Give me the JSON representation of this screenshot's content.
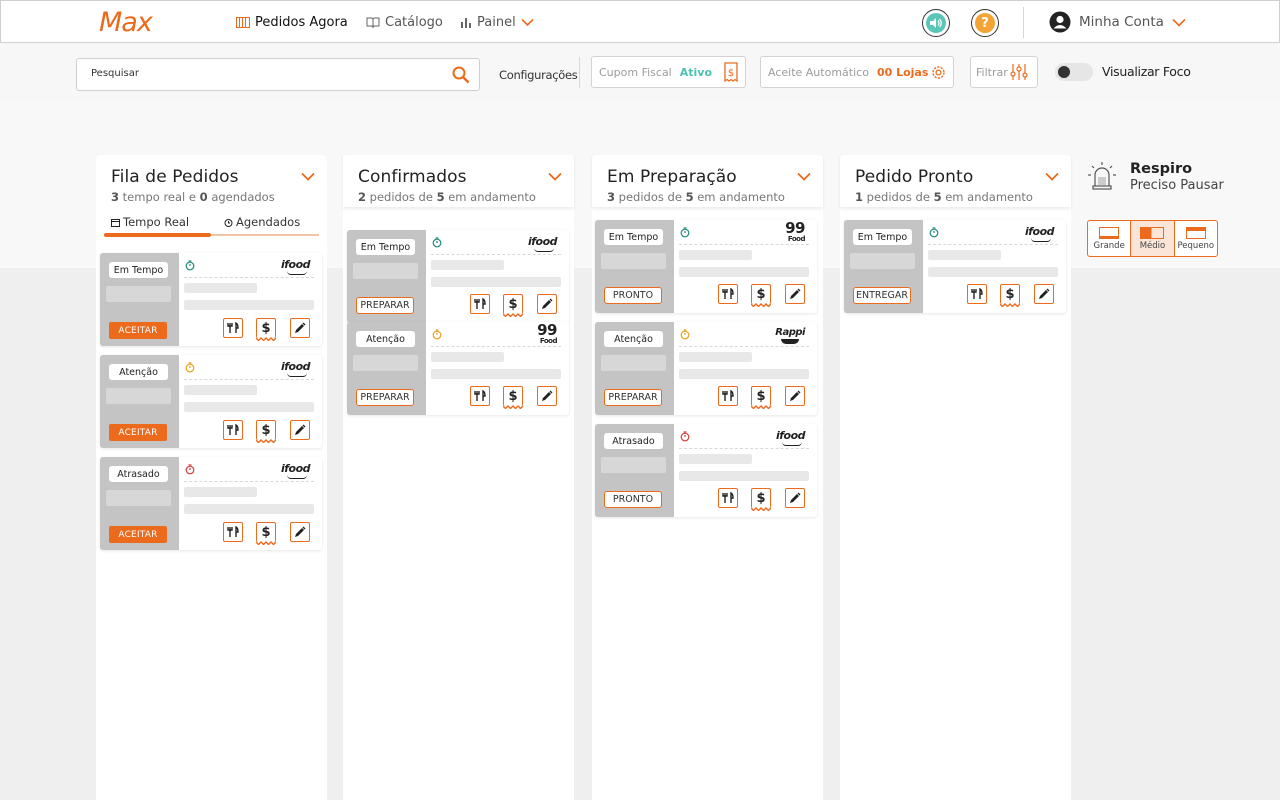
{
  "brand": {
    "logo": "Max",
    "accent": "#ec6a1c"
  },
  "nav": {
    "pedidos": "Pedidos Agora",
    "catalogo": "Catálogo",
    "painel": "Painel",
    "account": "Minha Conta"
  },
  "toolbar": {
    "search_placeholder": "Pesquisar",
    "config": "Configurações",
    "cupom_label": "Cupom Fiscal",
    "cupom_status": "Ativo",
    "aceite_label": "Aceite Automático",
    "aceite_value": "00 Lojas",
    "filtrar": "Filtrar",
    "foco": "Visualizar Foco"
  },
  "columns": [
    {
      "title": "Fila de Pedidos",
      "sub": {
        "n1": "3",
        "t1": "tempo real e",
        "n2": "0",
        "t2": "agendados"
      },
      "tabs": [
        "Tempo Real",
        "Agendados"
      ],
      "cards": [
        {
          "status": "Em Tempo",
          "action": "ACEITAR",
          "platform": "ifood",
          "clock_color": "#1f8a7a"
        },
        {
          "status": "Atenção",
          "action": "ACEITAR",
          "platform": "ifood",
          "clock_color": "#e6a11c"
        },
        {
          "status": "Atrasado",
          "action": "ACEITAR",
          "platform": "ifood",
          "clock_color": "#d93a3a"
        }
      ]
    },
    {
      "title": "Confirmados",
      "sub": {
        "n1": "2",
        "t1": "pedidos de",
        "n2": "5",
        "t2": "em andamento"
      },
      "cards": [
        {
          "status": "Em Tempo",
          "action": "PREPARAR",
          "platform": "ifood",
          "clock_color": "#1f8a7a"
        },
        {
          "status": "Atenção",
          "action": "PREPARAR",
          "platform": "99 Food",
          "clock_color": "#e6a11c"
        }
      ]
    },
    {
      "title": "Em Preparação",
      "sub": {
        "n1": "3",
        "t1": "pedidos de",
        "n2": "5",
        "t2": "em andamento"
      },
      "cards": [
        {
          "status": "Em Tempo",
          "action": "PRONTO",
          "platform": "99 Food",
          "clock_color": "#1f8a7a"
        },
        {
          "status": "Atenção",
          "action": "PREPARAR",
          "platform": "Rappi",
          "clock_color": "#e6a11c"
        },
        {
          "status": "Atrasado",
          "action": "PRONTO",
          "platform": "ifood",
          "clock_color": "#d93a3a"
        }
      ]
    },
    {
      "title": "Pedido Pronto",
      "sub": {
        "n1": "1",
        "t1": "pedidos de",
        "n2": "5",
        "t2": "em andamento"
      },
      "cards": [
        {
          "status": "Em Tempo",
          "action": "ENTREGAR",
          "platform": "ifood",
          "clock_color": "#1f8a7a"
        }
      ]
    }
  ],
  "respiro": {
    "title": "Respiro",
    "subtitle": "Preciso Pausar"
  },
  "sizes": {
    "options": [
      "Grande",
      "Médio",
      "Pequeno"
    ],
    "selected": "Médio"
  }
}
